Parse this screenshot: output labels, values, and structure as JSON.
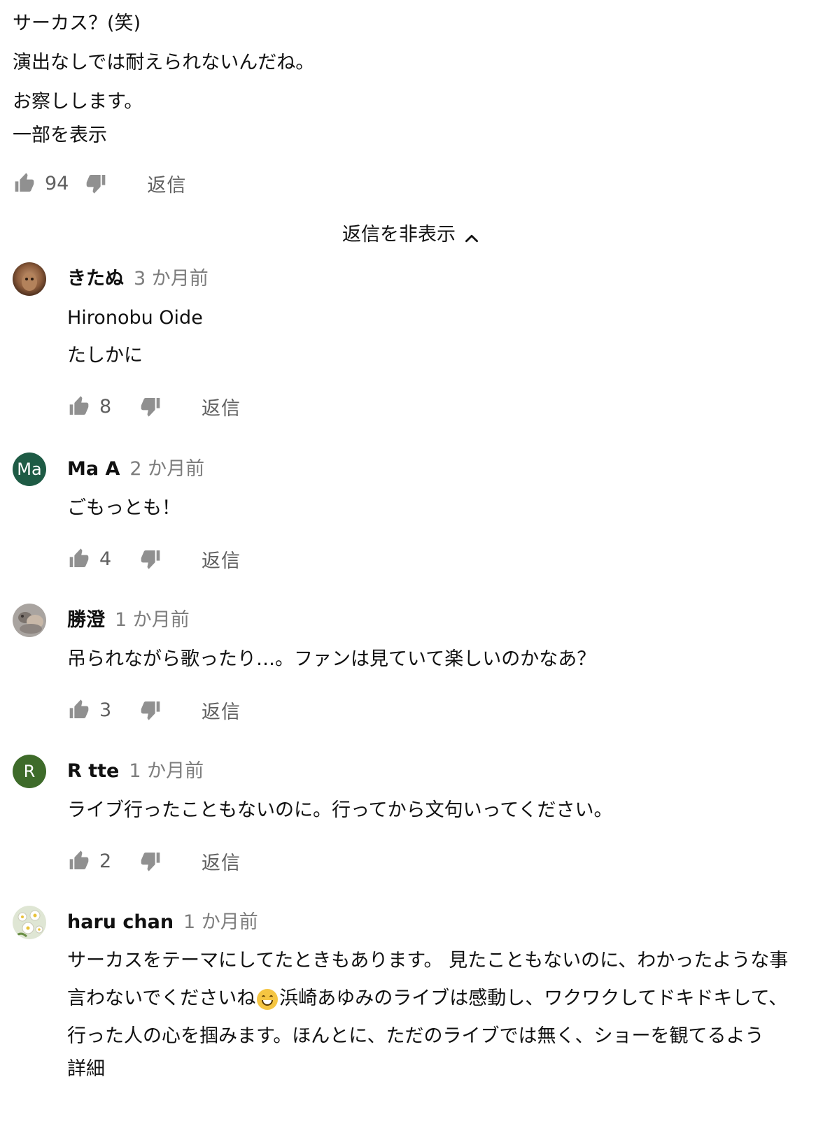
{
  "parent_comment": {
    "lines": [
      "サーカス？(笑)",
      "演出なしでは耐えられないんだね。",
      "お察しします。"
    ],
    "show_part_label": "一部を表示",
    "like_count": "94",
    "reply_label": "返信"
  },
  "hide_replies_label": "返信を非表示",
  "replies": [
    {
      "author": "きたぬ",
      "time": "3 か月前",
      "text_lines": [
        "Hironobu Oide",
        "たしかに"
      ],
      "like_count": "8",
      "reply_label": "返信"
    },
    {
      "author": "Ma A",
      "time": "2 か月前",
      "avatar_initials": "Ma",
      "avatar_color": "#1e5b45",
      "text_lines": [
        "ごもっとも！"
      ],
      "like_count": "4",
      "reply_label": "返信"
    },
    {
      "author": "勝澄",
      "time": "1 か月前",
      "text_lines": [
        "吊られながら歌ったり…。ファンは見ていて楽しいのかなあ？"
      ],
      "like_count": "3",
      "reply_label": "返信"
    },
    {
      "author": "R tte",
      "time": "1 か月前",
      "avatar_initials": "R",
      "avatar_color": "#3e6b2a",
      "text_lines": [
        "ライブ行ったこともないのに。行ってから文句いってください。"
      ],
      "like_count": "2",
      "reply_label": "返信"
    },
    {
      "author": "haru chan",
      "time": "1 か月前",
      "text_line_1": "サーカスをテーマにしてたときもあります。 見たこともないのに、わかったような事",
      "text_line_2a": "言わないでくださいね",
      "text_line_2b": "浜崎あゆみのライブは感動し、ワクワクしてドキドキして、",
      "text_line_3": "行った人の心を掴みます。ほんとに、ただのライブでは無く、ショーを観てるよう",
      "details_label": "詳細"
    }
  ],
  "icons": {
    "like": "thumb-up-icon",
    "dislike": "thumb-down-icon",
    "chevron": "chevron-up-icon",
    "emoji": "grinning-face-emoji"
  },
  "colors": {
    "text": "#111111",
    "secondary_text": "#606060",
    "timestamp": "#7d7d7d",
    "icon_gray": "#909090"
  }
}
